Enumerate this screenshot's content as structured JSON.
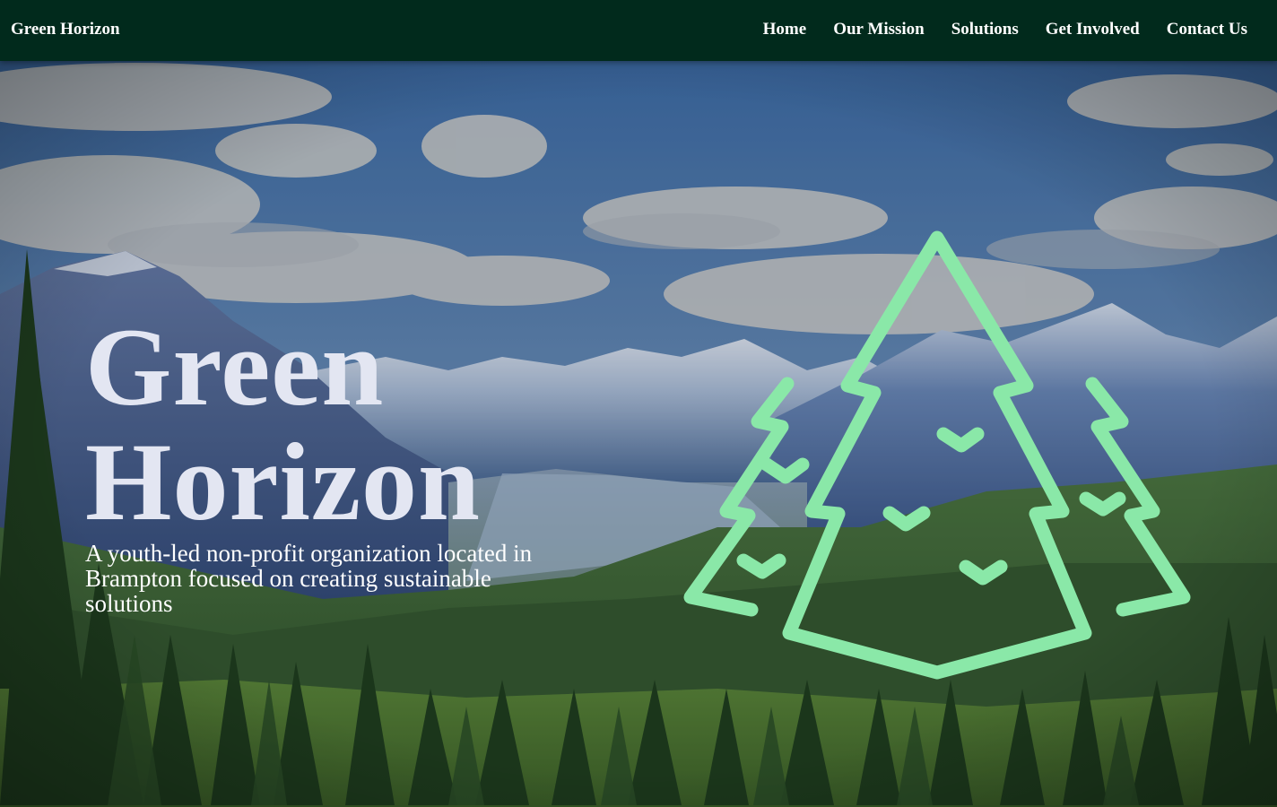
{
  "nav": {
    "brand": "Green Horizon",
    "links": [
      "Home",
      "Our Mission",
      "Solutions",
      "Get Involved",
      "Contact Us"
    ]
  },
  "hero": {
    "title_line1": "Green",
    "title_line2": "Horizon",
    "subtitle": "A youth-led non-profit organization located in Brampton focused on creating sustainable solutions",
    "logo_icon": "pine-trees-outline-icon",
    "background": "mountain-forest-landscape"
  },
  "colors": {
    "navbar": "#012a1c",
    "logo_stroke": "#8ae8a8",
    "title": "#e3e6f2",
    "text": "#ffffff"
  }
}
